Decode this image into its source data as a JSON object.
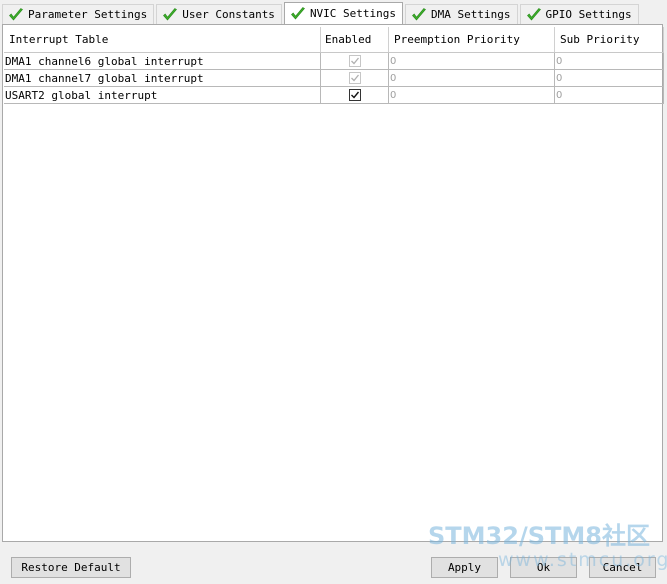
{
  "tabs": [
    {
      "label": "Parameter Settings",
      "active": false
    },
    {
      "label": "User Constants",
      "active": false
    },
    {
      "label": "NVIC Settings",
      "active": true
    },
    {
      "label": "DMA Settings",
      "active": false
    },
    {
      "label": "GPIO Settings",
      "active": false
    }
  ],
  "table": {
    "headers": [
      "Interrupt Table",
      "Enabled",
      "Preemption Priority",
      "Sub Priority"
    ],
    "rows": [
      {
        "name": "DMA1 channel6 global interrupt",
        "enabled": true,
        "editable": false,
        "preemption": "0",
        "sub": "0"
      },
      {
        "name": "DMA1 channel7 global interrupt",
        "enabled": true,
        "editable": false,
        "preemption": "0",
        "sub": "0"
      },
      {
        "name": "USART2 global interrupt",
        "enabled": true,
        "editable": true,
        "preemption": "0",
        "sub": "0"
      }
    ]
  },
  "buttons": {
    "restore": "Restore Default",
    "apply": "Apply",
    "ok": "Ok",
    "cancel": "Cancel"
  },
  "watermark": {
    "line1": "STM32/STM8社区",
    "line2": "www.stmcu.org"
  },
  "colors": {
    "tab_check": "#3cae2a",
    "panel_border": "#a9a9a9",
    "disabled_text": "#a0a0a0"
  },
  "icons": {
    "tab_status": "check-icon"
  }
}
